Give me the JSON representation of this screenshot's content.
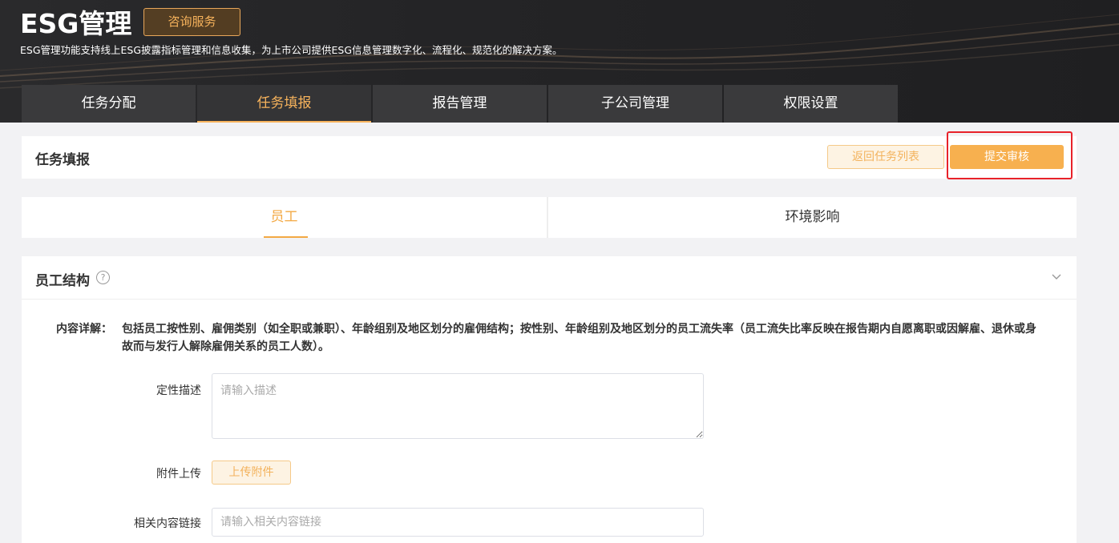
{
  "hero": {
    "title": "ESG管理",
    "consult_label": "咨询服务",
    "description": "ESG管理功能支持线上ESG披露指标管理和信息收集，为上市公司提供ESG信息管理数字化、流程化、规范化的解决方案。"
  },
  "nav": {
    "items": [
      {
        "label": "任务分配"
      },
      {
        "label": "任务填报"
      },
      {
        "label": "报告管理"
      },
      {
        "label": "子公司管理"
      },
      {
        "label": "权限设置"
      }
    ],
    "active_index": 1
  },
  "header": {
    "title": "任务填报",
    "back_label": "返回任务列表",
    "submit_label": "提交审核"
  },
  "tabs": {
    "items": [
      {
        "label": "员工"
      },
      {
        "label": "环境影响"
      }
    ],
    "active_index": 0
  },
  "section": {
    "title": "员工结构",
    "help_icon": "question-circle-icon",
    "collapse_icon": "chevron-down-icon",
    "detail_label": "内容详解：",
    "detail_text": "包括员工按性别、雇佣类别（如全职或兼职）、年龄组别及地区划分的雇佣结构；按性别、年龄组别及地区划分的员工流失率（员工流失比率反映在报告期内自愿离职或因解雇、退休或身故而与发行人解除雇佣关系的员工人数）。"
  },
  "form": {
    "desc_label": "定性描述",
    "desc_placeholder": "请输入描述",
    "upload_label": "附件上传",
    "upload_button": "上传附件",
    "link_label": "相关内容链接",
    "link_placeholder": "请输入相关内容链接"
  },
  "colors": {
    "accent": "#f7b04f",
    "hero_bg": "#242426",
    "highlight": "#e8222a"
  }
}
